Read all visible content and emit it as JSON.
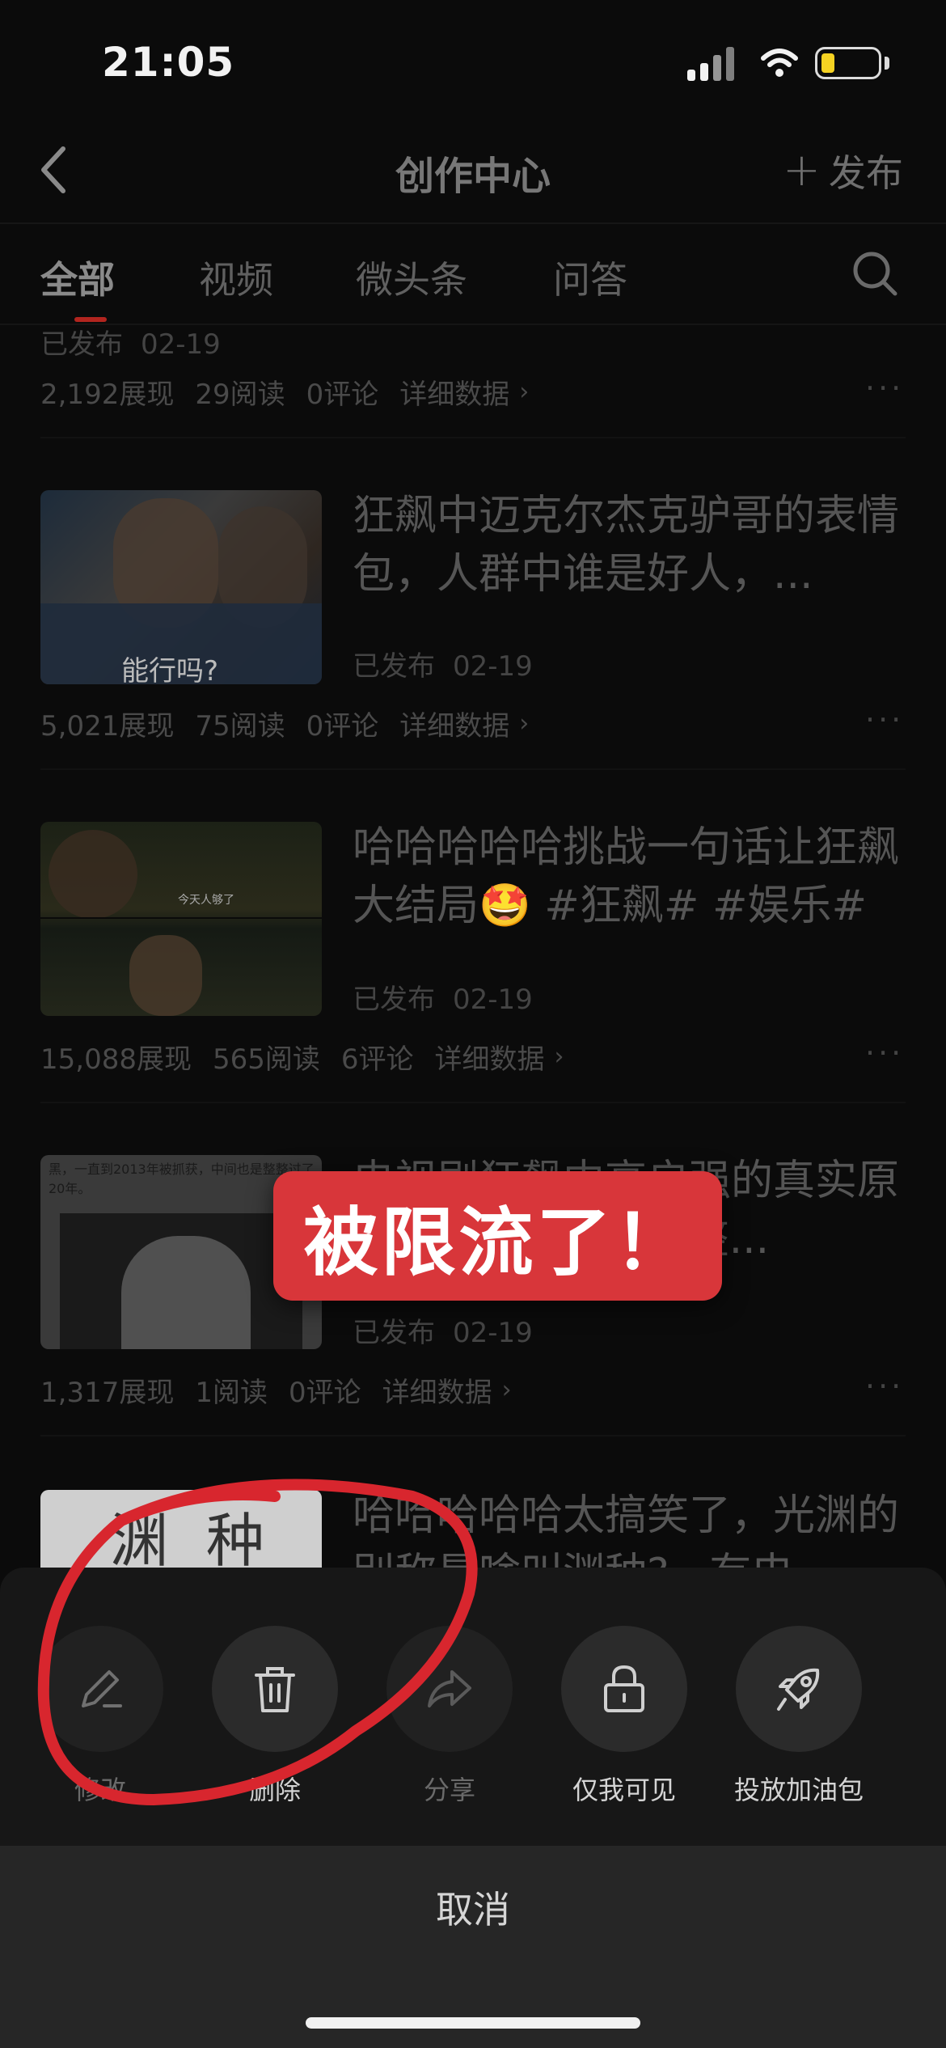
{
  "status_bar": {
    "time": "21:05"
  },
  "nav": {
    "title": "创作中心",
    "publish_plus": "+",
    "publish_label": "发布"
  },
  "tabs": [
    {
      "label": "全部"
    },
    {
      "label": "视频"
    },
    {
      "label": "微头条"
    },
    {
      "label": "问答"
    }
  ],
  "items": [
    {
      "title": "",
      "status": "已发布",
      "date": "02-19",
      "views": "2,192展现",
      "reads": "29阅读",
      "comments": "0评论",
      "details": "详细数据"
    },
    {
      "title": "狂飙中迈克尔杰克驴哥的表情包，人群中谁是好人，...",
      "thumb_caption": "能行吗?",
      "status": "已发布",
      "date": "02-19",
      "views": "5,021展现",
      "reads": "75阅读",
      "comments": "0评论",
      "details": "详细数据"
    },
    {
      "title": "哈哈哈哈哈挑战一句话让狂飙大结局🤩 #狂飙# #娱乐#",
      "thumb_caption": "今天人够了",
      "status": "已发布",
      "date": "02-19",
      "views": "15,088展现",
      "reads": "565阅读",
      "comments": "6评论",
      "details": "详细数据"
    },
    {
      "title": "电视剧狂飙中高启强的真实原型，...不仅秋也是整...",
      "thumb_caption": "黑，一直到2013年被抓获，中间也是整整过了20年。",
      "status": "已发布",
      "date": "02-19",
      "views": "1,317展现",
      "reads": "1阅读",
      "comments": "0评论",
      "details": "详细数据"
    },
    {
      "title": "哈哈哈哈哈太搞笑了，光渊的别称是啥叫渊种?...有电",
      "thumb_caption": "渊 种"
    }
  ],
  "banner": "被限流了！",
  "actions": [
    {
      "label": "修改"
    },
    {
      "label": "删除"
    },
    {
      "label": "分享"
    },
    {
      "label": "仅我可见"
    },
    {
      "label": "投放加油包"
    }
  ],
  "cancel_label": "取消",
  "colors": {
    "accent": "#d8363a",
    "tab_indicator": "#b2251f",
    "battery": "#f5d222"
  }
}
